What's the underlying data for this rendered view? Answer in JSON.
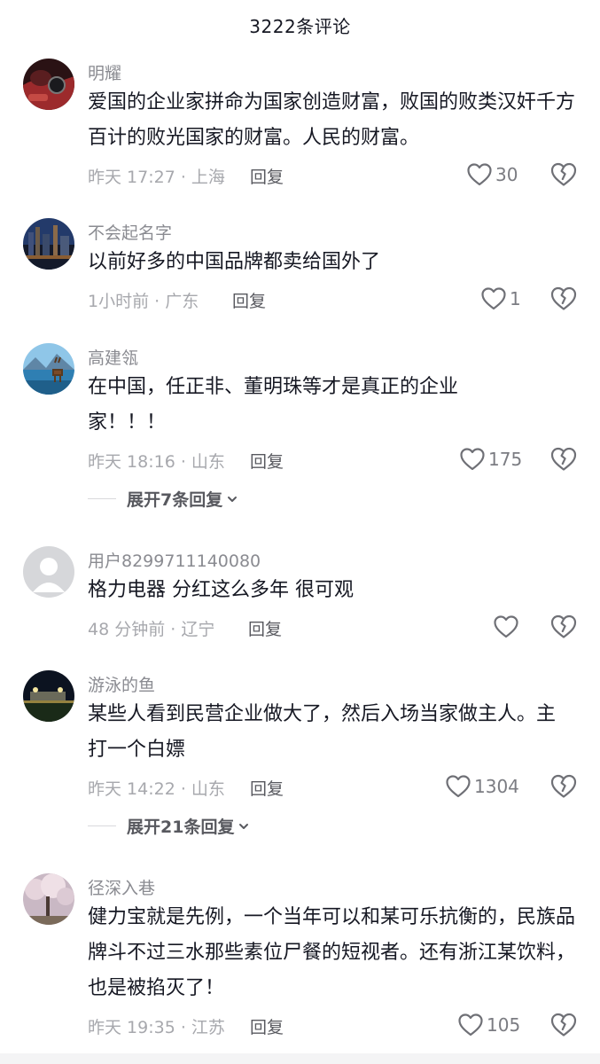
{
  "header": {
    "title": "3222条评论"
  },
  "comments": [
    {
      "username": "明耀",
      "text": "爱国的企业家拼命为国家创造财富，败国的败类汉奸千方百计的败光国家的财富。人民的财富。",
      "time": "昨天 17:27 · 上海",
      "reply": "回复",
      "likes": "30",
      "avatar": "car-interior-avatar"
    },
    {
      "username": "不会起名字",
      "text": "以前好多的中国品牌都卖给国外了",
      "time": "1小时前 · 广东",
      "reply": "回复",
      "likes": "1",
      "avatar": "city-night-avatar"
    },
    {
      "username": "高建瓴",
      "text": "在中国，任正非、董明珠等才是真正的企业家！！！",
      "time": "昨天 18:16 · 山东",
      "reply": "回复",
      "likes": "175",
      "avatar": "deer-lake-avatar",
      "expand": "展开7条回复"
    },
    {
      "username": "用户8299711140080",
      "text": "格力电器 分红这么多年 很可观",
      "time": "48 分钟前 · 辽宁",
      "reply": "回复",
      "likes": "",
      "avatar": "default-user-avatar"
    },
    {
      "username": "游泳的鱼",
      "text": "某些人看到民营企业做大了，然后入场当家做主人。主打一个白嫖",
      "time": "昨天 14:22 · 山东",
      "reply": "回复",
      "likes": "1304",
      "avatar": "night-stadium-avatar",
      "expand": "展开21条回复"
    },
    {
      "username": "径深入巷",
      "text": "健力宝就是先例，一个当年可以和某可乐抗衡的，民族品牌斗不过三水那些素位尸餐的短视者。还有浙江某饮料，也是被掐灭了！",
      "time": "昨天 19:35 · 江苏",
      "reply": "回复",
      "likes": "105",
      "avatar": "blossom-tree-avatar"
    }
  ],
  "colors": {
    "text": "#161823",
    "meta": "#a7a8ad",
    "username": "#8a8b91",
    "icon": "#6f7076"
  }
}
